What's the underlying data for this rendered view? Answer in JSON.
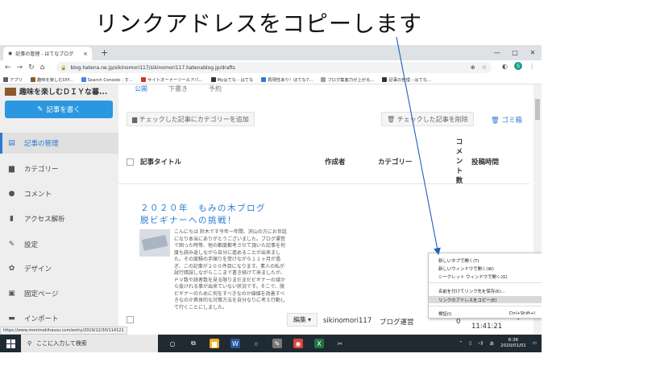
{
  "caption": "リンクアドレスをコピーします",
  "browser": {
    "tab_title": "記事の管理 - はてなブログ",
    "tab_close": "×",
    "new_tab": "+",
    "window_controls": [
      "—",
      "□",
      "✕"
    ],
    "url": "blog.hatena.ne.jp/sikinomori117/sikinomori117.hatenablog.jp/drafts",
    "avatar_letter": "S",
    "bookmarks": [
      {
        "label": "アプリ",
        "color": "#5f6368"
      },
      {
        "label": "趣味を楽しむDIY...",
        "color": "#8a5a2b"
      },
      {
        "label": "Search Console - す...",
        "color": "#4285f4"
      },
      {
        "label": "サイトオーナーツールアパ...",
        "color": "#d93025"
      },
      {
        "label": "Myはてな - はてな",
        "color": "#333333"
      },
      {
        "label": "再現性あり！ほてな7...",
        "color": "#2a7bd1"
      },
      {
        "label": "ブログ集客力が上がる...",
        "color": "#9aa0a6"
      },
      {
        "label": "記事の管理 - はてな...",
        "color": "#333333"
      }
    ]
  },
  "sidebar": {
    "blog_name": "趣味を楽しむＤＩＹな暮...",
    "write_button": "記事を書く",
    "items": [
      {
        "label": "記事の管理",
        "icon": "document-icon",
        "glyph": "▤",
        "active": true
      },
      {
        "label": "カテゴリー",
        "icon": "folder-icon",
        "glyph": "▆",
        "active": false
      },
      {
        "label": "コメント",
        "icon": "comment-icon",
        "glyph": "●",
        "active": false
      },
      {
        "label": "アクセス解析",
        "icon": "bar-chart-icon",
        "glyph": "▮",
        "active": false
      },
      {
        "label": "設定",
        "icon": "wrench-icon",
        "glyph": "✎",
        "active": false
      },
      {
        "label": "デザイン",
        "icon": "gear-icon",
        "glyph": "✿",
        "active": false
      },
      {
        "label": "固定ページ",
        "icon": "page-icon",
        "glyph": "▣",
        "active": false
      },
      {
        "label": "インポート",
        "icon": "truck-icon",
        "glyph": "▬",
        "active": false
      }
    ]
  },
  "main": {
    "top_tabs": [
      "公開",
      "下書き",
      "予約"
    ],
    "category_button": "チェックした記事にカテゴリーを追加",
    "delete_button": "チェックした記事を削除",
    "trash_link": "ゴミ箱",
    "columns": {
      "title": "記事タイトル",
      "author": "作成者",
      "category": "カテゴリー",
      "comments": [
        "コ",
        "メ",
        "ン",
        "ト",
        "数"
      ],
      "published": "投稿時間"
    },
    "post": {
      "title": "２０２０年　もみの木ブログ脱ビギナーへの挑戦！",
      "excerpt": "こんにちは 鈴木です今年一年間、沢山の方にお世話になり本当にありがとうございました。ブログ運営で困った時等、他の都度都考させて頂いた記事を何度も読み返しながら自分に進めることが出来ました。その度積の手順りを受けながら１１ヶ月が過ぎ、この記事が２００件目になります。素人の私が試行錯誤しながらここまで書き続けて来ましたが、ＰＶ数や読者数を見る限りまだまだビギナーの域から抜けれる事が出来ていない状況です。そこで、脱ビギナーのために何をすべきなのか値値を改善すべきなのか具体的な対策方法を自分なりに考え行動して行くことにしました。",
      "edit_button": "編集",
      "author": "sikinomori117",
      "category": "ブログ運営",
      "comment_count": "0",
      "time": "11:41:21"
    }
  },
  "context_menu": {
    "items": [
      {
        "label": "新しいタブで開く(T)",
        "shortcut": ""
      },
      {
        "label": "新しいウィンドウで開く(W)",
        "shortcut": ""
      },
      {
        "label": "シークレット ウィンドウで開く(G)",
        "shortcut": ""
      },
      {
        "label": "名前を付けてリンク先を保存(K)...",
        "shortcut": ""
      },
      {
        "label": "リンクのアドレスをコピー(E)",
        "shortcut": ""
      },
      {
        "label": "検証(I)",
        "shortcut": "Ctrl+Shift+I"
      }
    ]
  },
  "status_url": "https://www.mominokihausu.com/entry/2019/12/30/114121",
  "taskbar": {
    "search_placeholder": "ここに入力して検索",
    "time": "6:36",
    "date": "2020/01/01",
    "lang": "あ"
  }
}
